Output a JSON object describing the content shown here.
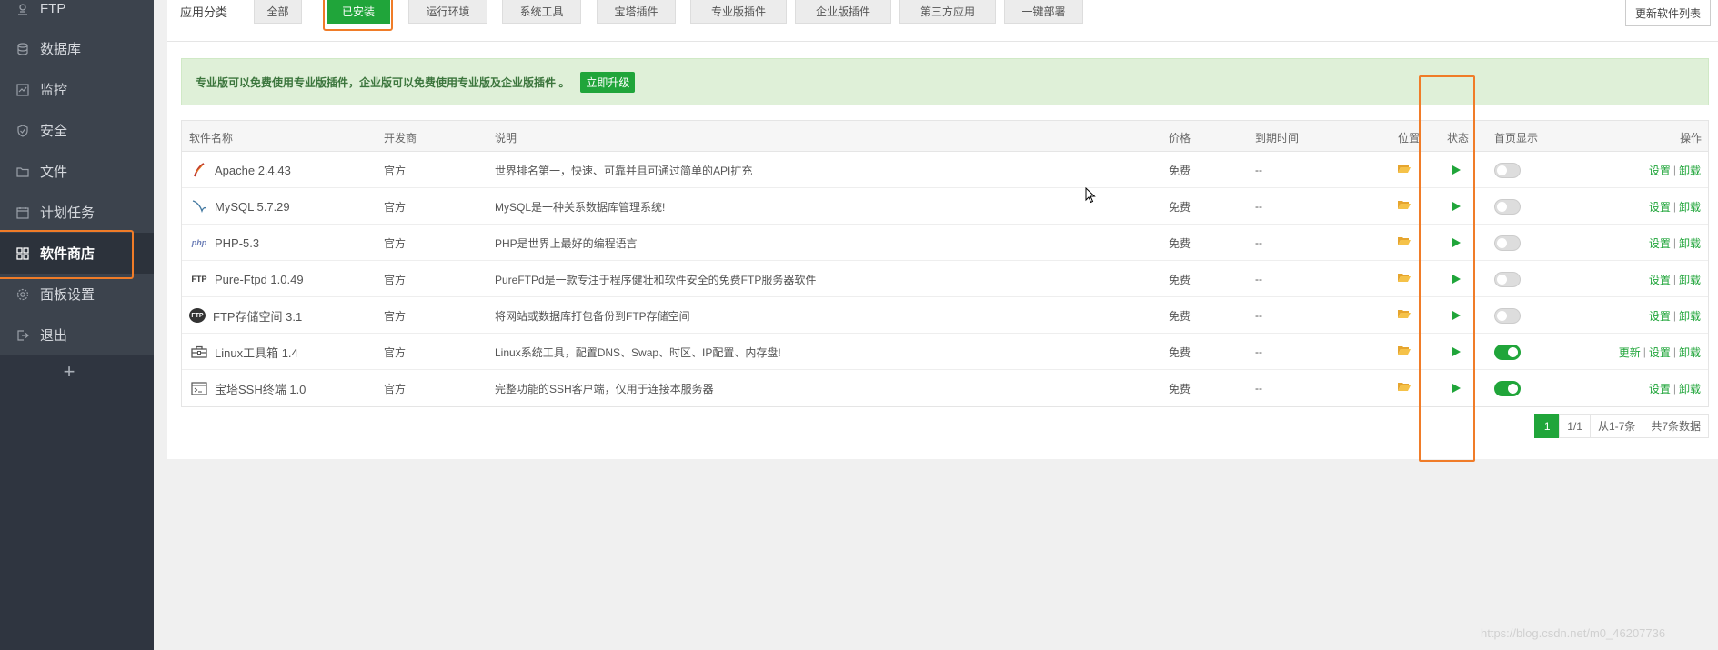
{
  "sidebar": {
    "items": [
      {
        "label": "FTP",
        "icon": "ftp-icon"
      },
      {
        "label": "数据库",
        "icon": "database-icon"
      },
      {
        "label": "监控",
        "icon": "monitor-icon"
      },
      {
        "label": "安全",
        "icon": "shield-icon"
      },
      {
        "label": "文件",
        "icon": "folder-icon"
      },
      {
        "label": "计划任务",
        "icon": "calendar-icon"
      },
      {
        "label": "软件商店",
        "icon": "grid-icon"
      },
      {
        "label": "面板设置",
        "icon": "gear-icon"
      },
      {
        "label": "退出",
        "icon": "logout-icon"
      }
    ],
    "add": "+"
  },
  "toolbar": {
    "category_label": "应用分类",
    "categories": [
      "全部",
      "已安装",
      "运行环境",
      "系统工具",
      "宝塔插件",
      "专业版插件",
      "企业版插件",
      "第三方应用",
      "一键部署"
    ],
    "update_button": "更新软件列表"
  },
  "notice": {
    "text": "专业版可以免费使用专业版插件，企业版可以免费使用专业版及企业版插件 。",
    "button": "立即升级"
  },
  "table": {
    "headers": [
      "软件名称",
      "开发商",
      "说明",
      "价格",
      "到期时间",
      "位置",
      "状态",
      "首页显示",
      "操作"
    ],
    "rows": [
      {
        "name": "Apache 2.4.43",
        "vendor": "官方",
        "desc": "世界排名第一，快速、可靠并且可通过简单的API扩充",
        "price": "免费",
        "expire": "--",
        "home": false,
        "ops": [
          "设置",
          "卸载"
        ],
        "icon": "apache-feather-icon"
      },
      {
        "name": "MySQL 5.7.29",
        "vendor": "官方",
        "desc": "MySQL是一种关系数据库管理系统!",
        "price": "免费",
        "expire": "--",
        "home": false,
        "ops": [
          "设置",
          "卸载"
        ],
        "icon": "mysql-dolphin-icon"
      },
      {
        "name": "PHP-5.3",
        "vendor": "官方",
        "desc": "PHP是世界上最好的编程语言",
        "price": "免费",
        "expire": "--",
        "home": false,
        "ops": [
          "设置",
          "卸载"
        ],
        "icon": "php-logo-icon",
        "icon_text": "php"
      },
      {
        "name": "Pure-Ftpd 1.0.49",
        "vendor": "官方",
        "desc": "PureFTPd是一款专注于程序健壮和软件安全的免费FTP服务器软件",
        "price": "免费",
        "expire": "--",
        "home": false,
        "ops": [
          "设置",
          "卸载"
        ],
        "icon": "ftp-logo-icon",
        "icon_text": "FTP"
      },
      {
        "name": "FTP存储空间 3.1",
        "vendor": "官方",
        "desc": "将网站或数据库打包备份到FTP存储空间",
        "price": "免费",
        "expire": "--",
        "home": false,
        "ops": [
          "设置",
          "卸载"
        ],
        "icon": "ftp-cloud-icon",
        "icon_text": "FTP"
      },
      {
        "name": "Linux工具箱 1.4",
        "vendor": "官方",
        "desc": "Linux系统工具，配置DNS、Swap、时区、IP配置、内存盘!",
        "price": "免费",
        "expire": "--",
        "home": true,
        "ops": [
          "更新",
          "设置",
          "卸载"
        ],
        "icon": "toolbox-icon"
      },
      {
        "name": "宝塔SSH终端 1.0",
        "vendor": "官方",
        "desc": "完整功能的SSH客户端，仅用于连接本服务器",
        "price": "免费",
        "expire": "--",
        "home": true,
        "ops": [
          "设置",
          "卸载"
        ],
        "icon": "terminal-icon"
      }
    ]
  },
  "pager": {
    "current": "1",
    "pages": "1/1",
    "range": "从1-7条",
    "total": "共7条数据"
  },
  "watermark": "https://blog.csdn.net/m0_46207736",
  "colors": {
    "accent": "#20a53a",
    "highlight": "#f07c28",
    "sidebar": "#3c434d"
  }
}
